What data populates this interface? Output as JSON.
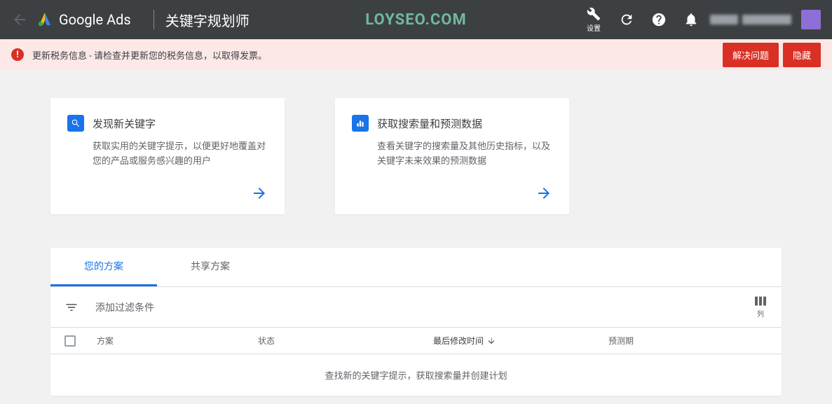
{
  "header": {
    "product": "Google Ads",
    "page_title": "关键字规划师",
    "watermark": "LOYSEO.COM",
    "settings_label": "设置"
  },
  "alert": {
    "text": "更新税务信息 - 请检查并更新您的税务信息，以取得发票。",
    "resolve_label": "解决问题",
    "hide_label": "隐藏"
  },
  "cards": {
    "discover": {
      "title": "发现新关键字",
      "desc": "获取实用的关键字提示，以便更好地覆盖对您的产品或服务感兴趣的用户"
    },
    "volume": {
      "title": "获取搜索量和预测数据",
      "desc": "查看关键字的搜索量及其他历史指标，以及关键字未来效果的预测数据"
    }
  },
  "plans": {
    "tabs": {
      "your_plans": "您的方案",
      "shared_plans": "共享方案"
    },
    "filter_placeholder": "添加过滤条件",
    "columns_label": "列",
    "columns": {
      "plan": "方案",
      "status": "状态",
      "last_modified": "最后修改时间",
      "forecast_period": "预测期"
    },
    "empty_message": "查找新的关键字提示，获取搜索量并创建计划"
  }
}
